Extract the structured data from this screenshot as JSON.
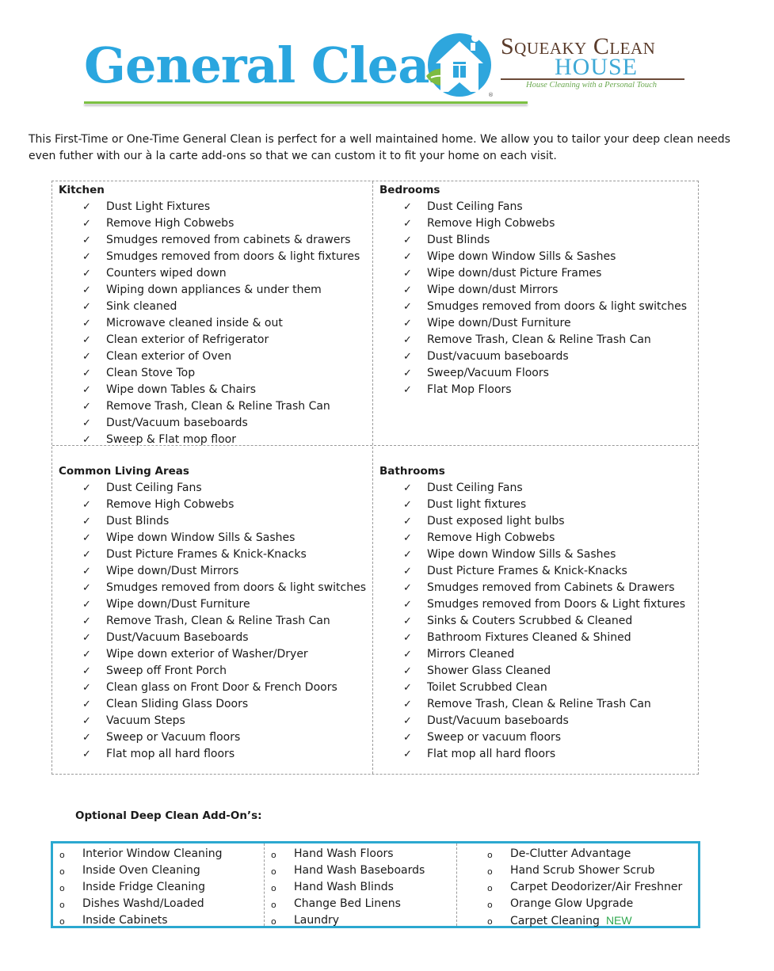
{
  "header": {
    "title": "General Clean",
    "brand": {
      "name": "Squeaky Clean",
      "sub": "HOUSE",
      "tagline": "House Cleaning with a Personal Touch",
      "registered_mark": "®",
      "logo_icon": "house-icon"
    },
    "colors": {
      "title": "#2aa6df",
      "rule": "#7cc142",
      "brand_name": "#5a3b2a",
      "brand_sub": "#3fa9d6",
      "tagline": "#6aa84f"
    }
  },
  "intro": "This First-Time or One-Time General Clean is perfect for a well maintained home.  We allow you to tailor your deep clean needs even futher with our à la carte add-ons so that we can custom it to fit your home on each visit.",
  "check_glyph": "✓",
  "bullet_glyph": "o",
  "sections": {
    "kitchen": {
      "heading": "Kitchen",
      "items": [
        "Dust Light Fixtures",
        "Remove High Cobwebs",
        "Smudges removed from cabinets & drawers",
        "Smudges removed from doors & light fixtures",
        "Counters wiped down",
        "Wiping down appliances & under them",
        "Sink cleaned",
        "Microwave cleaned inside & out",
        "Clean exterior of Refrigerator",
        "Clean exterior of Oven",
        "Clean Stove Top",
        "Wipe down Tables & Chairs",
        "Remove Trash, Clean & Reline Trash Can",
        "Dust/Vacuum baseboards",
        "Sweep & Flat mop floor"
      ]
    },
    "bedrooms": {
      "heading": "Bedrooms",
      "items": [
        "Dust Ceiling Fans",
        "Remove High Cobwebs",
        "Dust Blinds",
        "Wipe down Window Sills & Sashes",
        "Wipe down/dust Picture Frames",
        "Wipe down/dust Mirrors",
        "Smudges removed from doors & light switches",
        "Wipe down/Dust Furniture",
        "Remove Trash, Clean & Reline Trash Can",
        "Dust/vacuum baseboards",
        "Sweep/Vacuum Floors",
        "Flat Mop Floors"
      ]
    },
    "living": {
      "heading": "Common Living Areas",
      "items": [
        "Dust Ceiling Fans",
        "Remove High Cobwebs",
        "Dust Blinds",
        "Wipe down Window Sills & Sashes",
        "Dust Picture Frames & Knick-Knacks",
        "Wipe down/Dust Mirrors",
        "Smudges removed from doors & light switches",
        "Wipe down/Dust Furniture",
        "Remove Trash, Clean & Reline Trash Can",
        "Dust/Vacuum Baseboards",
        "Wipe down exterior of Washer/Dryer",
        "Sweep off Front Porch",
        "Clean glass on Front Door & French Doors",
        "Clean Sliding Glass Doors",
        "Vacuum Steps",
        "Sweep or Vacuum floors",
        "Flat mop all hard floors"
      ]
    },
    "bathrooms": {
      "heading": "Bathrooms",
      "items": [
        "Dust Ceiling Fans",
        "Dust light fixtures",
        "Dust exposed light bulbs",
        "Remove High Cobwebs",
        "Wipe down Window Sills & Sashes",
        "Dust Picture Frames & Knick-Knacks",
        "Smudges removed from Cabinets & Drawers",
        "Smudges removed from Doors & Light fixtures",
        "Sinks & Couters Scrubbed & Cleaned",
        "Bathroom Fixtures Cleaned & Shined",
        "Mirrors Cleaned",
        "Shower Glass Cleaned",
        "Toilet Scrubbed Clean",
        "Remove Trash, Clean & Reline Trash Can",
        "Dust/Vacuum baseboards",
        "Sweep or vacuum floors",
        "Flat mop all hard floors"
      ]
    }
  },
  "addons": {
    "title": "Optional Deep Clean Add-On’s:",
    "border_color": "#2ba8d0",
    "columns": [
      [
        "Interior Window Cleaning",
        "Inside Oven Cleaning",
        "Inside Fridge Cleaning",
        "Dishes Washd/Loaded",
        "Inside Cabinets"
      ],
      [
        "Hand Wash Floors",
        "Hand Wash Baseboards",
        "Hand Wash Blinds",
        "Change Bed Linens",
        "Laundry"
      ],
      [
        "De-Clutter Advantage",
        "Hand Scrub Shower Scrub",
        "Carpet Deodorizer/Air Freshner",
        "Orange Glow Upgrade",
        "Carpet Cleaning"
      ]
    ],
    "new_badge": {
      "label": "NEW",
      "color": "#2fa84f"
    }
  }
}
